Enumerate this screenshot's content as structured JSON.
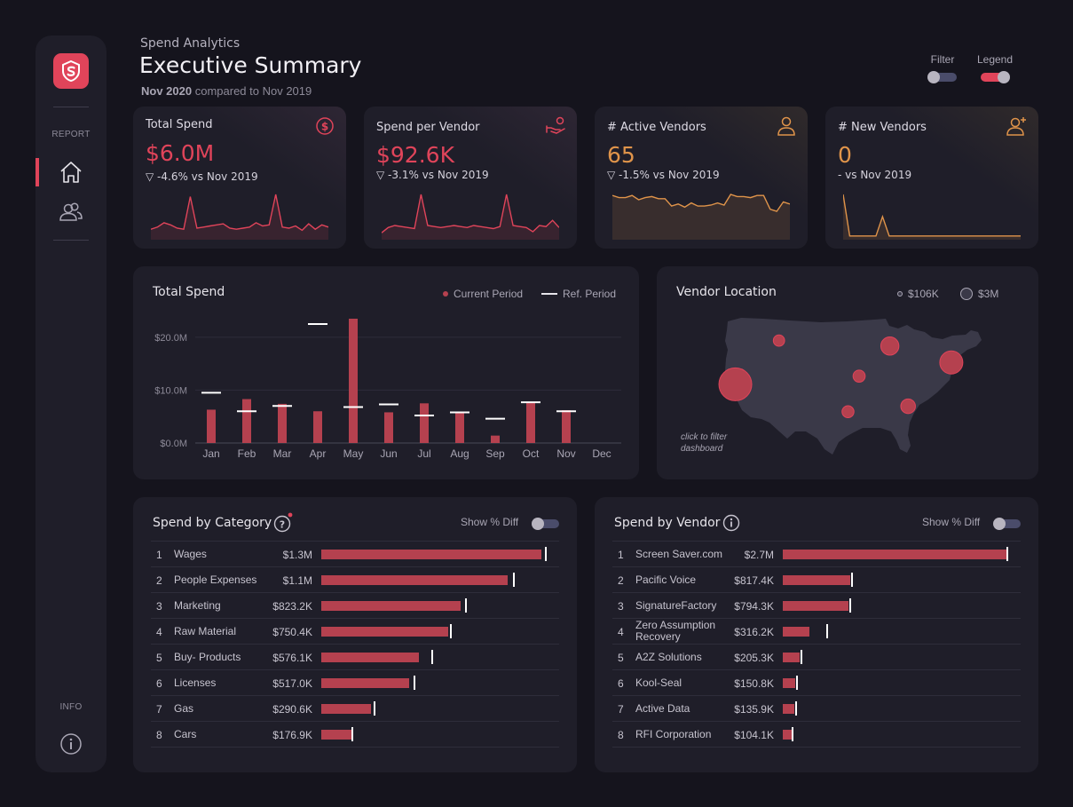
{
  "sidebar": {
    "report_caption": "REPORT",
    "info_caption": "INFO",
    "nav": [
      {
        "name": "home",
        "icon": "home-icon",
        "active": true
      },
      {
        "name": "vendors",
        "icon": "users-icon",
        "active": false
      }
    ]
  },
  "header": {
    "kicker": "Spend Analytics",
    "title": "Executive Summary",
    "period": "Nov 2020",
    "comparison": "compared to Nov 2019",
    "filter_label": "Filter",
    "filter_on": false,
    "legend_label": "Legend",
    "legend_on": true
  },
  "colors": {
    "accent": "#e0445a",
    "bar": "#b5414f",
    "orange": "#e0944a",
    "panel": "#1f1e29",
    "background": "#15141d"
  },
  "kpis": [
    {
      "title": "Total Spend",
      "value": "$6.0M",
      "delta": "▽ -4.6% vs Nov 2019",
      "icon": "dollar-circle-icon",
      "color": "#e0445a",
      "spark": [
        8,
        10,
        14,
        12,
        9,
        8,
        38,
        9,
        10,
        11,
        12,
        13,
        9,
        8,
        9,
        10,
        14,
        11,
        12,
        40,
        10,
        9,
        11,
        7,
        13,
        8,
        12,
        10
      ]
    },
    {
      "title": "Spend per Vendor",
      "value": "$92.6K",
      "delta": "▽ -3.1% vs Nov 2019",
      "icon": "hand-coin-icon",
      "color": "#e0445a",
      "spark": [
        5,
        10,
        12,
        11,
        10,
        9,
        42,
        12,
        11,
        10,
        11,
        12,
        11,
        10,
        12,
        11,
        10,
        9,
        11,
        42,
        12,
        11,
        10,
        6,
        12,
        11,
        17,
        10
      ]
    },
    {
      "title": "# Active Vendors",
      "value": "65",
      "delta": "▽ -1.5% vs Nov 2019",
      "icon": "user-icon",
      "color": "#e0944a",
      "spark": [
        40,
        38,
        38,
        40,
        36,
        38,
        39,
        37,
        37,
        30,
        32,
        29,
        33,
        30,
        30,
        31,
        33,
        31,
        41,
        39,
        39,
        38,
        40,
        40,
        27,
        25,
        34,
        32
      ]
    },
    {
      "title": "# New Vendors",
      "value": "0",
      "delta": "- vs Nov 2019",
      "icon": "user-plus-icon",
      "color": "#e0944a",
      "spark": [
        45,
        2,
        2,
        2,
        2,
        2,
        22,
        2,
        2,
        2,
        2,
        2,
        2,
        2,
        2,
        2,
        2,
        2,
        2,
        2,
        2,
        2,
        2,
        2,
        2,
        2,
        2,
        2
      ]
    }
  ],
  "total_spend": {
    "title": "Total Spend",
    "legend_current": "Current Period",
    "legend_ref": "Ref. Period"
  },
  "chart_data": {
    "type": "bar",
    "title": "Total Spend",
    "categories": [
      "Jan",
      "Feb",
      "Mar",
      "Apr",
      "May",
      "Jun",
      "Jul",
      "Aug",
      "Sep",
      "Oct",
      "Nov",
      "Dec"
    ],
    "y_ticks": [
      "$0.0M",
      "$10.0M",
      "$20.0M"
    ],
    "ylim": [
      0,
      24
    ],
    "series": [
      {
        "name": "Current Period",
        "values": [
          6.3,
          8.3,
          7.4,
          6.0,
          23.5,
          5.8,
          7.5,
          5.8,
          1.4,
          7.7,
          6.2,
          null
        ]
      },
      {
        "name": "Ref. Period",
        "values": [
          9.5,
          6.0,
          7.0,
          22.5,
          6.8,
          7.3,
          5.2,
          5.8,
          4.6,
          7.7,
          6.0,
          null
        ]
      }
    ],
    "legend": "top-right",
    "grid": true
  },
  "vendor_location": {
    "title": "Vendor Location",
    "legend_small": "$106K",
    "legend_large": "$3M",
    "hint": "click to filter dashboard",
    "bubbles": [
      {
        "lon": -122.3,
        "lat": 37.5,
        "size": 3.0
      },
      {
        "lon": -112.5,
        "lat": 45.5,
        "size": 0.11
      },
      {
        "lon": -87.6,
        "lat": 44.5,
        "size": 0.6
      },
      {
        "lon": -73.8,
        "lat": 41.5,
        "size": 1.2
      },
      {
        "lon": -94.5,
        "lat": 39.0,
        "size": 0.15
      },
      {
        "lon": -97.0,
        "lat": 32.5,
        "size": 0.14
      },
      {
        "lon": -83.5,
        "lat": 33.5,
        "size": 0.3
      }
    ]
  },
  "spend_by_category": {
    "title": "Spend by Category",
    "show_diff": "Show % Diff",
    "help_icon": "help-icon",
    "rows": [
      {
        "rank": "1",
        "name": "Wages",
        "value": "$1.3M",
        "amount": 1.3,
        "ref": 1.32
      },
      {
        "rank": "2",
        "name": "People Expenses",
        "value": "$1.1M",
        "amount": 1.1,
        "ref": 1.13
      },
      {
        "rank": "3",
        "name": "Marketing",
        "value": "$823.2K",
        "amount": 0.8232,
        "ref": 0.85
      },
      {
        "rank": "4",
        "name": "Raw Material",
        "value": "$750.4K",
        "amount": 0.7504,
        "ref": 0.76
      },
      {
        "rank": "5",
        "name": "Buy- Products",
        "value": "$576.1K",
        "amount": 0.5761,
        "ref": 0.65
      },
      {
        "rank": "6",
        "name": "Licenses",
        "value": "$517.0K",
        "amount": 0.517,
        "ref": 0.545
      },
      {
        "rank": "7",
        "name": "Gas",
        "value": "$290.6K",
        "amount": 0.2906,
        "ref": 0.31
      },
      {
        "rank": "8",
        "name": "Cars",
        "value": "$176.9K",
        "amount": 0.1769,
        "ref": 0.18
      }
    ]
  },
  "spend_by_vendor": {
    "title": "Spend by Vendor",
    "show_diff": "Show % Diff",
    "info_icon": "info-icon",
    "rows": [
      {
        "rank": "1",
        "name": "Screen Saver.com",
        "value": "$2.7M",
        "amount": 2.7,
        "ref": 2.7
      },
      {
        "rank": "2",
        "name": "Pacific Voice",
        "value": "$817.4K",
        "amount": 0.8174,
        "ref": 0.82
      },
      {
        "rank": "3",
        "name": "SignatureFactory",
        "value": "$794.3K",
        "amount": 0.7943,
        "ref": 0.8
      },
      {
        "rank": "4",
        "name": "Zero Assumption Recovery",
        "value": "$316.2K",
        "amount": 0.3162,
        "ref": 0.52
      },
      {
        "rank": "5",
        "name": "A2Z Solutions",
        "value": "$205.3K",
        "amount": 0.2053,
        "ref": 0.21
      },
      {
        "rank": "6",
        "name": "Kool-Seal",
        "value": "$150.8K",
        "amount": 0.1508,
        "ref": 0.16
      },
      {
        "rank": "7",
        "name": "Active Data",
        "value": "$135.9K",
        "amount": 0.1359,
        "ref": 0.15
      },
      {
        "rank": "8",
        "name": "RFI Corporation",
        "value": "$104.1K",
        "amount": 0.1041,
        "ref": 0.11
      }
    ]
  }
}
